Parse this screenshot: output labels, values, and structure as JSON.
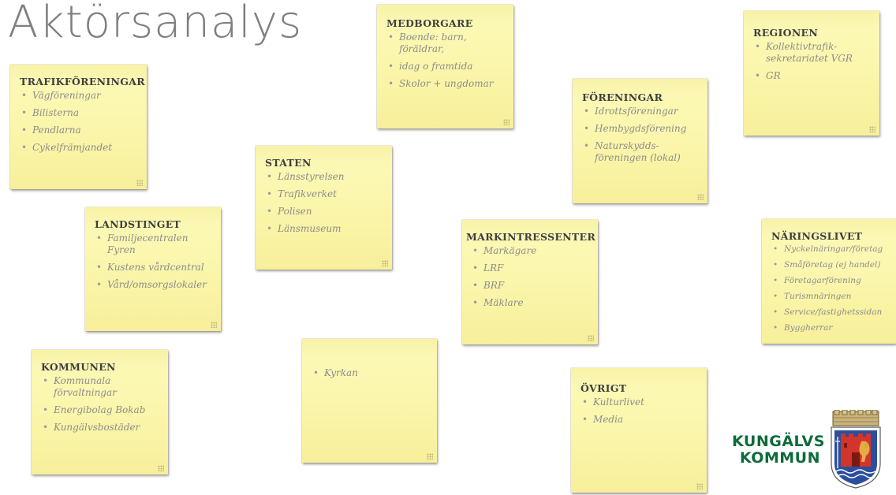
{
  "slide": {
    "title": "Aktörsanalys"
  },
  "notes": {
    "trafik": {
      "header": "TRAFIKFÖRENINGAR",
      "items": [
        "Vägföreningar",
        "Bilisterna",
        "Pendlarna",
        "Cykelfrämjandet"
      ]
    },
    "medborgare": {
      "header": "MEDBORGARE",
      "items": [
        "Boende: barn, föräldrar,",
        "idag o framtida",
        "Skolor + ungdomar"
      ]
    },
    "regionen": {
      "header": "REGIONEN",
      "items": [
        "Kollektivtrafik-sekretariatet VGR",
        "GR"
      ]
    },
    "foreningar": {
      "header": "FÖRENINGAR",
      "items": [
        "Idrottsföreningar",
        "Hembygdsförening",
        "Naturskydds-föreningen (lokal)"
      ]
    },
    "staten": {
      "header": "STATEN",
      "items": [
        "Länsstyrelsen",
        "Trafikverket",
        "Polisen",
        "Länsmuseum"
      ]
    },
    "landstinget": {
      "header": "LANDSTINGET",
      "items": [
        "Familjecentralen Fyren",
        "Kustens vårdcentral",
        "Vård/omsorgslokaler"
      ]
    },
    "markintressenter": {
      "header": "MARKINTRESSENTER",
      "items": [
        "Markägare",
        "LRF",
        "BRF",
        "Mäklare"
      ]
    },
    "naringslivet": {
      "header": "NÄRINGSLIVET",
      "items": [
        "Nyckelnäringar/företag",
        "Småföretag (ej handel)",
        "Företagarförening",
        "Turismnäringen",
        "Service/fastighetssidan",
        "Byggherrar"
      ]
    },
    "kommunen": {
      "header": "KOMMUNEN",
      "items": [
        "Kommunala förvaltningar",
        "Energibolag Bokab",
        "Kungälvsbostäder"
      ]
    },
    "kyrkan": {
      "header": "",
      "items": [
        "Kyrkan"
      ]
    },
    "ovrigt": {
      "header": "ÖVRIGT",
      "items": [
        "Kulturlivet",
        "Media"
      ]
    }
  },
  "logo": {
    "line1": "KUNGÄLVS",
    "line2": "KOMMUN",
    "brand_color": "#0e6b3c",
    "crest_icon": "kungalv-coat-of-arms-icon"
  },
  "colors": {
    "note_yellow": "#fbf7ae",
    "title_gray": "#7f7f7f"
  }
}
